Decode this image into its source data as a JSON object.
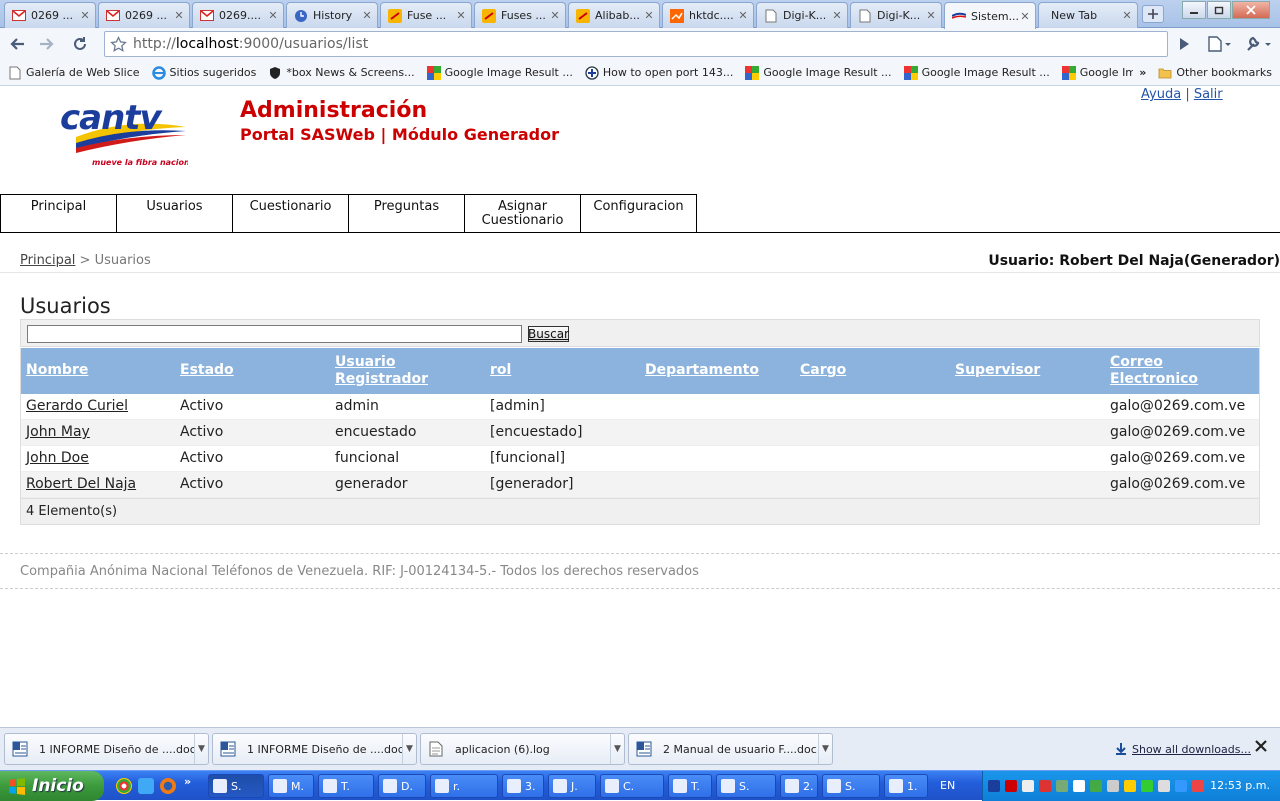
{
  "browser": {
    "tabs": [
      {
        "title": "0269 ...",
        "icon": "gmail-icon"
      },
      {
        "title": "0269 ...",
        "icon": "gmail-icon"
      },
      {
        "title": "0269....",
        "icon": "gmail-icon"
      },
      {
        "title": "History",
        "icon": "clock-icon"
      },
      {
        "title": "Fuse ...",
        "icon": "alibaba-icon"
      },
      {
        "title": "Fuses ...",
        "icon": "alibaba-icon"
      },
      {
        "title": "Alibab...",
        "icon": "alibaba-icon"
      },
      {
        "title": "hktdc....",
        "icon": "hktdc-icon"
      },
      {
        "title": "Digi-K...",
        "icon": "page-icon"
      },
      {
        "title": "Digi-K...",
        "icon": "page-icon"
      },
      {
        "title": "Sistem...",
        "icon": "cantv-icon",
        "active": true
      },
      {
        "title": "New Tab",
        "icon": "none"
      }
    ],
    "url_prefix": "http://",
    "url_host": "localhost",
    "url_rest": ":9000/usuarios/list",
    "bookmarks": [
      {
        "label": "Galería de Web Slice",
        "icon": "page-icon"
      },
      {
        "label": "Sitios sugeridos",
        "icon": "ie-icon"
      },
      {
        "label": "*box News & Screens...",
        "icon": "shield-icon"
      },
      {
        "label": "Google Image Result ...",
        "icon": "google-icon"
      },
      {
        "label": "How to open port 143...",
        "icon": "plus-circle-icon"
      },
      {
        "label": "Google Image Result ...",
        "icon": "google-icon"
      },
      {
        "label": "Google Image Result ...",
        "icon": "google-icon"
      },
      {
        "label": "Google Image Result ...",
        "icon": "google-icon"
      }
    ],
    "bookmarks_overflow": "»",
    "other_bookmarks": "Other bookmarks"
  },
  "header": {
    "logo_text": "cantv",
    "logo_tagline": "mueve la fibra nacional",
    "title": "Administración",
    "subtitle": "Portal SASWeb | Módulo Generador",
    "help_link": "Ayuda",
    "separator": "|",
    "logout_link": "Salir"
  },
  "menu": [
    {
      "label": "Principal"
    },
    {
      "label": "Usuarios"
    },
    {
      "label": "Cuestionario"
    },
    {
      "label": "Preguntas"
    },
    {
      "label": "Asignar\nCuestionario"
    },
    {
      "label": "Configuracion"
    }
  ],
  "breadcrumb": {
    "home": "Principal",
    "sep": " > ",
    "current": "Usuarios"
  },
  "user_label": "Usuario: Robert Del Naja(Generador)",
  "section_title": "Usuarios",
  "search": {
    "value": "",
    "button_label": "Buscar"
  },
  "table": {
    "columns": [
      "Nombre",
      "Estado",
      "Usuario\nRegistrador",
      "rol",
      "Departamento",
      "Cargo",
      "Supervisor",
      "Correo\nElectronico"
    ],
    "rows": [
      [
        "Gerardo Curiel",
        "Activo",
        "admin",
        "[admin]",
        "",
        "",
        "",
        "galo@0269.com.ve"
      ],
      [
        "John May",
        "Activo",
        "encuestado",
        "[encuestado]",
        "",
        "",
        "",
        "galo@0269.com.ve"
      ],
      [
        "John Doe",
        "Activo",
        "funcional",
        "[funcional]",
        "",
        "",
        "",
        "galo@0269.com.ve"
      ],
      [
        "Robert Del Naja",
        "Activo",
        "generador",
        "[generador]",
        "",
        "",
        "",
        "galo@0269.com.ve"
      ]
    ],
    "footer": "4 Elemento(s)"
  },
  "footer_text": "Compañia Anónima Nacional Teléfonos de Venezuela. RIF: J-00124134-5.- Todos los derechos reservados",
  "downloads": {
    "items": [
      {
        "name": "1 INFORME Diseño de ....doc",
        "icon": "word-doc-icon"
      },
      {
        "name": "1 INFORME Diseño de ....doc",
        "icon": "word-doc-icon"
      },
      {
        "name": "aplicacion (6).log",
        "icon": "log-file-icon"
      },
      {
        "name": "2 Manual de usuario F....doc",
        "icon": "word-doc-icon"
      }
    ],
    "show_all": "Show all downloads..."
  },
  "taskbar": {
    "start_label": "Inicio",
    "tasks": [
      "S.",
      "M.",
      "T.",
      "D.",
      "r.",
      "3.",
      "J.",
      "C.",
      "T.",
      "S.",
      "2.",
      "S.",
      "1."
    ],
    "lang": "EN",
    "clock": "12:53 p.m."
  },
  "colors": {
    "brand_red": "#cc0000",
    "table_header": "#8cb3de"
  }
}
